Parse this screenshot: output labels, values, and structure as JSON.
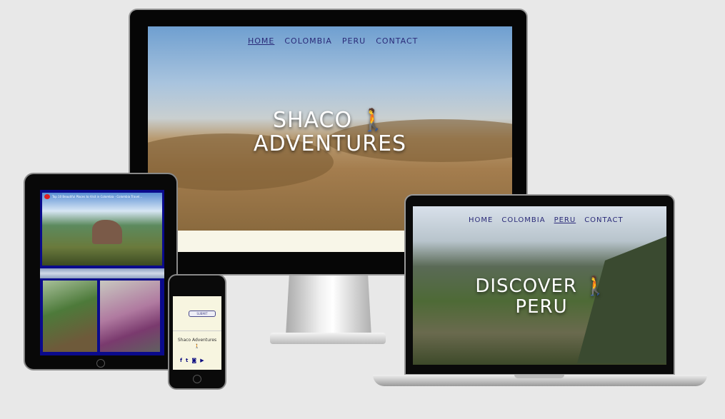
{
  "desktop": {
    "nav": [
      "HOME",
      "COLOMBIA",
      "PERU",
      "CONTACT"
    ],
    "active_nav": "HOME",
    "title_line1": "SHACO",
    "title_line2": "ADVENTURES",
    "icon": "hiker-icon"
  },
  "laptop": {
    "nav": [
      "HOME",
      "COLOMBIA",
      "PERU",
      "CONTACT"
    ],
    "active_nav": "PERU",
    "title_line1": "DISCOVER",
    "title_line2": "PERU",
    "icon": "hiker-icon"
  },
  "tablet": {
    "video_title": "Top 10 Beautiful Places to Visit in Colombia - Colombia Travel..."
  },
  "phone": {
    "submit_label": "SUBMIT",
    "footer_name": "Shaco Adventures",
    "social": [
      "f",
      "t",
      "ig",
      "yt"
    ]
  }
}
